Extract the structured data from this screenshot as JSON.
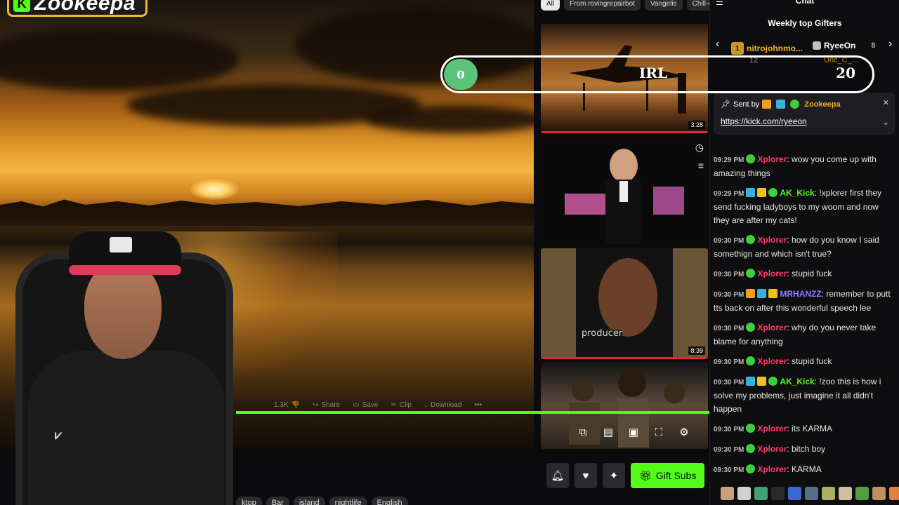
{
  "stream": {
    "logo_text": "Zookeepa",
    "logo_icon": "kick-k-icon",
    "brand_color": "#53fc18",
    "progress_fraction": 1.0,
    "controls": [
      {
        "label": "1.3K",
        "icon": "dislike-icon"
      },
      {
        "label": "Share",
        "icon": "share-icon"
      },
      {
        "label": "Save",
        "icon": "save-icon"
      },
      {
        "label": "Clip",
        "icon": "scissors-icon"
      },
      {
        "label": "Download",
        "icon": "download-icon"
      },
      {
        "label": "",
        "icon": "more-icon"
      }
    ],
    "player_icons": [
      "picture-in-picture-icon",
      "theater-icon",
      "miniplayer-icon",
      "fullscreen-icon",
      "settings-icon"
    ],
    "gift_subs_label": "Gift Subs",
    "tags": [
      "ktop",
      "Bar",
      "island",
      "nightlife",
      "English"
    ]
  },
  "related": {
    "filters": [
      "All",
      "From rovingrepairbot",
      "Vangelis",
      "Chill-out"
    ],
    "thumbs": [
      {
        "duration": "3:28"
      },
      {
        "duration": ""
      },
      {
        "duration": "8:39",
        "caption": "producer"
      },
      {
        "duration": ""
      }
    ]
  },
  "goal": {
    "current": "0",
    "label": "IRL",
    "target": "20",
    "fill_color": "#5cc47a",
    "progress_fraction": 0
  },
  "chat": {
    "title": "Chat",
    "gifters_title": "Weekly top Gifters",
    "gifters": [
      {
        "rank": "1",
        "name": "nitrojohnmo...",
        "count": "12"
      },
      {
        "name": "RyeeOn",
        "count": "8"
      },
      {
        "name": "Unc_C_...",
        "count": ""
      }
    ],
    "pinned": {
      "sent_by_label": "Sent by",
      "user": "Zookeepa",
      "link": "https://kick.com/ryeeon"
    },
    "messages": [
      {
        "time": "09:29 PM",
        "user": "Xplorer",
        "color": "#ff3b6b",
        "badges": [
          "verified"
        ],
        "text": ": wow you come up with amazing things"
      },
      {
        "time": "09:29 PM",
        "user": "AK_Kick",
        "color": "#53fc18",
        "badges": [
          "sub",
          "gift",
          "verified"
        ],
        "text": ": !xplorer first they send fucking ladyboys to my woom and now they are after my cats!"
      },
      {
        "time": "09:30 PM",
        "user": "Xplorer",
        "color": "#ff3b6b",
        "badges": [
          "verified"
        ],
        "text": ": how do you know I said somethign and which isn't true?"
      },
      {
        "time": "09:30 PM",
        "user": "Xplorer",
        "color": "#ff3b6b",
        "badges": [
          "verified"
        ],
        "text": ": stupid fuck"
      },
      {
        "time": "09:30 PM",
        "user": "MRHANZZ",
        "color": "#8a7cff",
        "badges": [
          "crown",
          "sub",
          "gift"
        ],
        "text": ": remember to putt tts back on after this wonderful speech lee"
      },
      {
        "time": "09:30 PM",
        "user": "Xplorer",
        "color": "#ff3b6b",
        "badges": [
          "verified"
        ],
        "text": ": why do you never take blame for anything"
      },
      {
        "time": "09:30 PM",
        "user": "Xplorer",
        "color": "#ff3b6b",
        "badges": [
          "verified"
        ],
        "text": ": stupid fuck"
      },
      {
        "time": "09:30 PM",
        "user": "AK_Kick",
        "color": "#53fc18",
        "badges": [
          "sub",
          "gift",
          "verified"
        ],
        "text": ": !zoo this is how i solve my problems, just imagine it all didn't happen"
      },
      {
        "time": "09:30 PM",
        "user": "Xplorer",
        "color": "#ff3b6b",
        "badges": [
          "verified"
        ],
        "text": ": its KARMA"
      },
      {
        "time": "09:30 PM",
        "user": "Xplorer",
        "color": "#ff3b6b",
        "badges": [
          "verified"
        ],
        "text": ": bitch boy"
      },
      {
        "time": "09:30 PM",
        "user": "Xplorer",
        "color": "#ff3b6b",
        "badges": [
          "verified"
        ],
        "text": ": KARMA"
      }
    ],
    "emote_colors": [
      "#c8a07a",
      "#d0d0d0",
      "#3fa070",
      "#2a2a2a",
      "#3a6ad0",
      "#5a6a8a",
      "#aab060",
      "#d0c0a0",
      "#50a040",
      "#c0905a",
      "#e08040",
      "#7ab0e0"
    ]
  }
}
